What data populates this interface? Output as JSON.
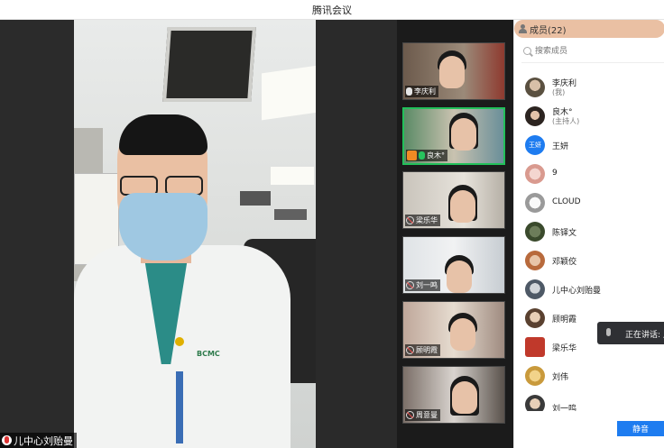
{
  "window": {
    "title": "腾讯会议"
  },
  "main_video": {
    "name": "儿中心刘贻曼",
    "logo_text": "BCMC"
  },
  "thumbnails": [
    {
      "name": "李庆利",
      "mic": "on",
      "host": false
    },
    {
      "name": "良木°",
      "mic": "green",
      "host": true
    },
    {
      "name": "梁乐华",
      "mic": "off",
      "host": false
    },
    {
      "name": "刘一鸣",
      "mic": "off",
      "host": false
    },
    {
      "name": "顾明霞",
      "mic": "off",
      "host": false
    },
    {
      "name": "周意曼",
      "mic": "off",
      "host": false
    }
  ],
  "members_panel": {
    "title": "成员(22)",
    "search_placeholder": "搜索成员",
    "members": [
      {
        "name": "李庆利",
        "role": "(我)",
        "avatar": "photo"
      },
      {
        "name": "良木°",
        "role": "(主持人)",
        "avatar": "photo"
      },
      {
        "name": "王妍",
        "role": "",
        "avatar": "王妍"
      },
      {
        "name": "9",
        "role": "",
        "avatar": "photo"
      },
      {
        "name": "CLOUD",
        "role": "",
        "avatar": "photo"
      },
      {
        "name": "陈铎文",
        "role": "",
        "avatar": "photo"
      },
      {
        "name": "邓颖佼",
        "role": "",
        "avatar": "photo"
      },
      {
        "name": "儿中心刘贻曼",
        "role": "",
        "avatar": "photo"
      },
      {
        "name": "顾明霞",
        "role": "",
        "avatar": "photo"
      },
      {
        "name": "梁乐华",
        "role": "",
        "avatar": "photo"
      },
      {
        "name": "刘伟",
        "role": "",
        "avatar": "photo"
      },
      {
        "name": "刘一鸣",
        "role": "",
        "avatar": "photo"
      }
    ]
  },
  "speaking_toast": {
    "text": "正在讲话: 儿"
  },
  "mute_button": {
    "label": "静音"
  },
  "colors": {
    "accent": "#1e7cf0",
    "active_border": "#22c05a",
    "panel_bg": "#ffffff"
  }
}
